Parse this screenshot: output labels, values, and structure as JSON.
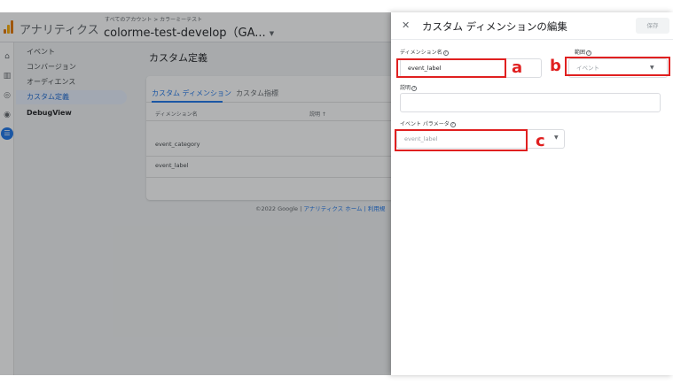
{
  "app": {
    "name": "アナリティクス",
    "breadcrumb": "すべてのアカウント > カラーミーテスト",
    "property": "colorme-test-develop（GA...",
    "caret": "▼"
  },
  "nav": {
    "items": [
      {
        "label": "イベント"
      },
      {
        "label": "コンバージョン"
      },
      {
        "label": "オーディエンス"
      },
      {
        "label": "カスタム定義"
      },
      {
        "label": "DebugView"
      }
    ]
  },
  "rail_icons": [
    "home-icon",
    "reports-icon",
    "explore-icon",
    "advertising-icon",
    "configure-icon"
  ],
  "main": {
    "title": "カスタム定義",
    "tabs": [
      {
        "label": "カスタム ディメンション"
      },
      {
        "label": "カスタム指標"
      }
    ],
    "columns": [
      {
        "label": "ディメンション名"
      },
      {
        "label": "説明 ↑"
      }
    ],
    "rows": [
      {
        "name": "event_category"
      },
      {
        "name": "event_label"
      }
    ],
    "footer_prefix": "©2022 Google | ",
    "footer_link": "アナリティクス ホーム | 利用規"
  },
  "panel": {
    "close": "✕",
    "title": "カスタム ディメンションの編集",
    "save_label": "保存",
    "dimension_name_label": "ディメンション名",
    "dimension_name_value": "event_label",
    "scope_label": "範囲",
    "scope_value": "イベント",
    "description_label": "説明",
    "description_value": "",
    "event_param_label": "イベント パラメータ",
    "event_param_value": "event_label",
    "help_glyph": "?",
    "dropdown_caret": "▼"
  },
  "annotations": {
    "a": "a",
    "b": "b",
    "c": "c",
    "color": "#e02020"
  }
}
